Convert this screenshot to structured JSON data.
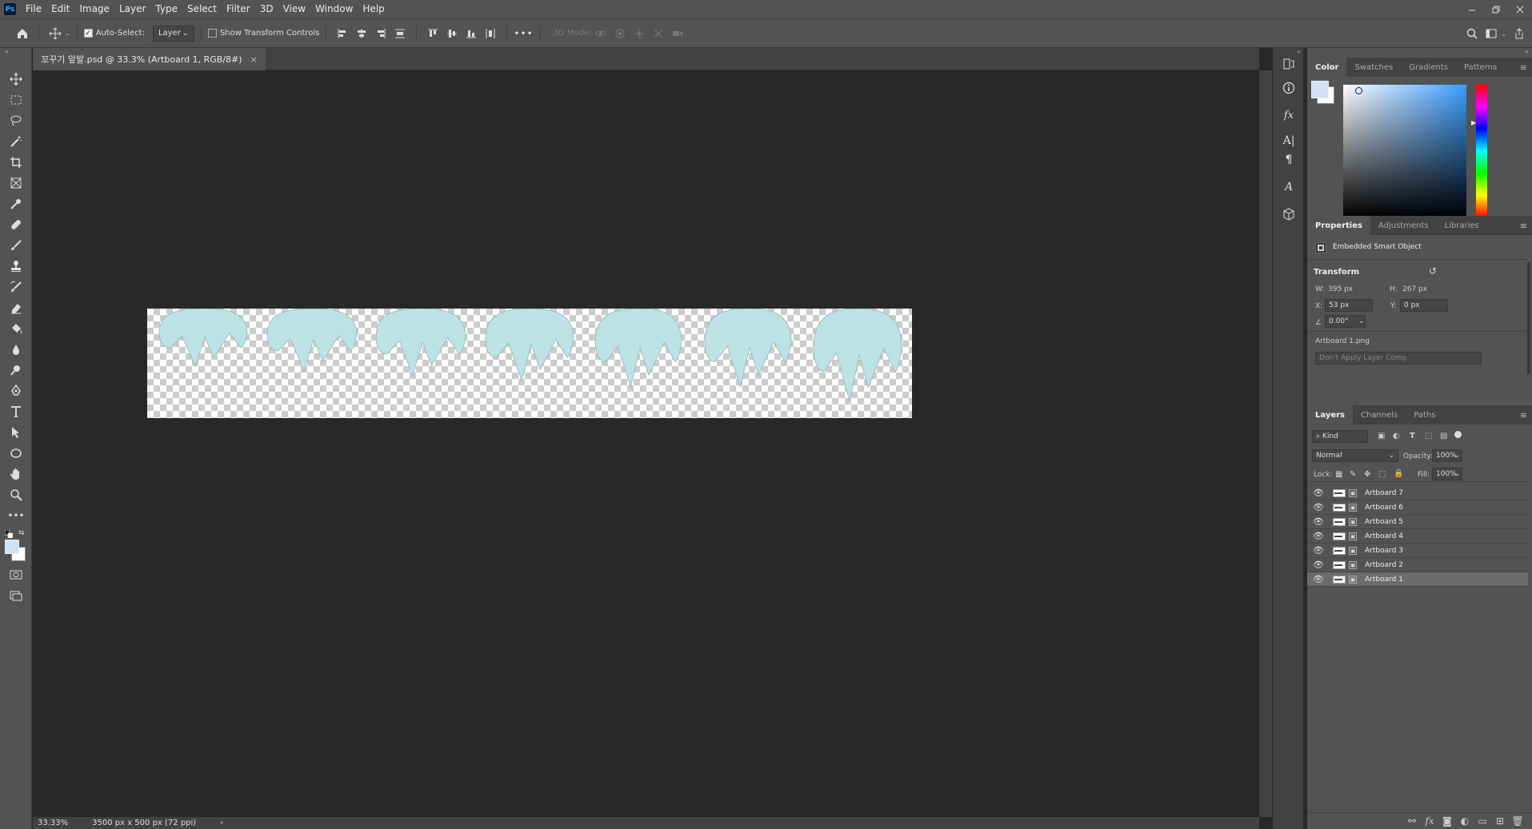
{
  "menubar": {
    "logo": "Ps",
    "items": [
      "File",
      "Edit",
      "Image",
      "Layer",
      "Type",
      "Select",
      "Filter",
      "3D",
      "View",
      "Window",
      "Help"
    ]
  },
  "options": {
    "auto_select_label": "Auto-Select:",
    "auto_select_checked": true,
    "auto_select_target": "Layer",
    "transform_controls_label": "Show Transform Controls",
    "mode_3d_label": "3D Mode:",
    "more": "•••"
  },
  "document": {
    "tab_title": "꼬꾸기 앞발.psd @ 33.3% (Artboard 1, RGB/8#)",
    "close": "×",
    "shape_color": "#bde2e3"
  },
  "status": {
    "zoom": "33.33%",
    "doc_info": "3500 px x 500 px (72 ppi)",
    "arrow": "›"
  },
  "color_panel": {
    "tabs": [
      "Color",
      "Swatches",
      "Gradients",
      "Patterns"
    ],
    "active_tab": "Color",
    "fg": "#cfe3f5",
    "bg": "#ffffff",
    "hue_color": "#3a9cff"
  },
  "properties": {
    "tabs": [
      "Properties",
      "Adjustments",
      "Libraries"
    ],
    "type": "Embedded Smart Object",
    "section": "Transform",
    "w_label": "W:",
    "w": "395 px",
    "h_label": "H:",
    "h": "267 px",
    "x_label": "X:",
    "x": "53 px",
    "y_label": "Y:",
    "y": "0 px",
    "angle": "0.00°",
    "file": "Artboard 1.png",
    "layer_comp": "Don't Apply Layer Comp"
  },
  "layers": {
    "tabs": [
      "Layers",
      "Channels",
      "Paths"
    ],
    "filter": "Kind",
    "blend": "Normal",
    "opacity_label": "Opacity:",
    "opacity": "100%",
    "lock_label": "Lock:",
    "fill_label": "Fill:",
    "fill": "100%",
    "items": [
      "Artboard 7",
      "Artboard 6",
      "Artboard 5",
      "Artboard 4",
      "Artboard 3",
      "Artboard 2",
      "Artboard 1"
    ],
    "selected": "Artboard 1"
  }
}
